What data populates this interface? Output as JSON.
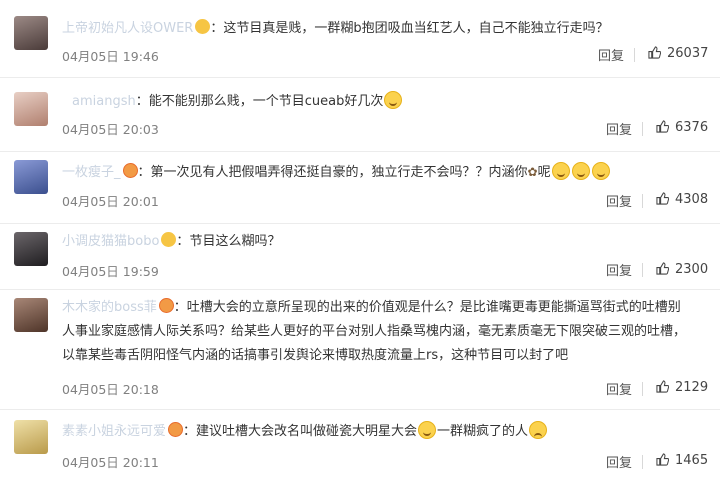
{
  "comments": [
    {
      "username": "上帝初始凡人设OWER",
      "text": "这节目真是贱，一群糊b抱团吸血当红艺人，自己不能独立行走吗？",
      "date": "04月05日 19:46",
      "reply_label": "回复",
      "likes": "26037",
      "badge": "gold-v",
      "avatar_color": "#6b5a55"
    },
    {
      "username": "amiangsh",
      "text": "能不能别那么贱，一个节目cueab好几次",
      "emojis": [
        "sweat-smile-icon"
      ],
      "date": "04月05日 20:03",
      "reply_label": "回复",
      "likes": "6376",
      "badge": "none",
      "avatar_color": "#c9a49b"
    },
    {
      "username": "一枚瘦子_",
      "text": "第一次见有人把假唱弄得还挺自豪的，独立行走不会吗？？内涵你",
      "text_after": "呢",
      "emojis": [
        "laugh-icon",
        "laugh-icon",
        "laugh-icon"
      ],
      "date": "04月05日 20:01",
      "reply_label": "回复",
      "likes": "4308",
      "badge": "red-heart",
      "avatar_color": "#5b6fa8"
    },
    {
      "username": "小调皮猫猫bobo",
      "text": "节目这么糊吗？",
      "date": "04月05日 19:59",
      "reply_label": "回复",
      "likes": "2300",
      "badge": "gold-v",
      "avatar_color": "#3c3a3e"
    },
    {
      "username": "木木家的boss菲",
      "text": "吐槽大会的立意所呈现的出来的价值观是什么？是比谁嘴更毒更能撕逼骂街式的吐槽别人事业家庭感情人际关系吗？给某些人更好的平台对别人指桑骂槐内涵，毫无素质毫无下限突破三观的吐槽，以靠某些毒舌阴阳怪气内涵的话搞事引发舆论来博取热度流量上rs，这种节目可以封了吧",
      "date": "04月05日 20:18",
      "reply_label": "回复",
      "likes": "2129",
      "badge": "red-heart",
      "avatar_color": "#7a5c4c"
    },
    {
      "username": "素素小姐永远可爱",
      "text": "建议吐槽大会改名叫做碰瓷大明星大会",
      "text_after": "一群糊疯了的人",
      "emojis": [
        "grin-icon",
        "sad-icon"
      ],
      "date": "04月05日 20:11",
      "reply_label": "回复",
      "likes": "1465",
      "badge": "red-heart",
      "avatar_color": "#d9c48a"
    }
  ],
  "colors": {
    "username": "#c9d3e0",
    "text": "#333333",
    "date": "#808080",
    "divider": "#ececec"
  }
}
